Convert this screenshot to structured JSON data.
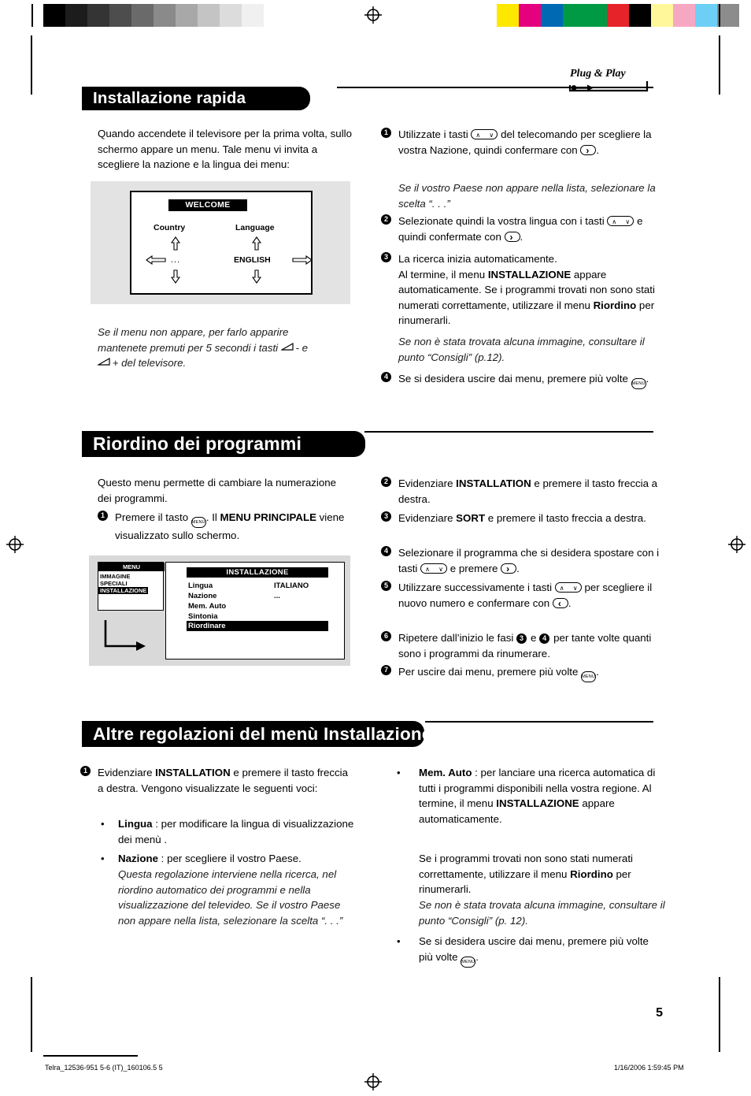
{
  "print_marks": {
    "gray_swatches": [
      "#000000",
      "#1a1a1a",
      "#333333",
      "#4d4d4d",
      "#666666",
      "#808080",
      "#999999",
      "#b3b3b3",
      "#cccccc",
      "#e6e6e6",
      "#ffffff"
    ],
    "color_swatches": [
      "#ffffff",
      "#ffee00",
      "#ec008c",
      "#0066b3",
      "#00a651",
      "#00a651",
      "#ed1c24",
      "#000000",
      "#fff799",
      "#f7a8c4",
      "#6dcff6",
      "#808080"
    ]
  },
  "brand": {
    "plug_and_play": "Plug & Play"
  },
  "sections": [
    {
      "id": "installazione-rapida",
      "title": "Installazione rapida",
      "intro": "Quando accendete il televisore per la prima volta, sullo schermo appare un menu. Tale menu vi invita a scegliere la nazione e la lingua dei menu:",
      "caption_italic": "Se il menu non appare, per farlo apparire mantenete premuti per 5 secondi i tasti      - e      + del televisore.",
      "screen": {
        "header": "WELCOME",
        "col1_label": "Country",
        "col2_label": "Language",
        "col1_value": "...",
        "col2_value": "ENGLISH"
      },
      "steps": [
        {
          "n": "1",
          "text_parts": [
            "Utilizzate i tasti ",
            " del telecomando per scegliere la vostra Nazione, quindi confermare con ",
            "."
          ],
          "note": "Se il vostro Paese non appare nella lista, selezionare la scelta “. . .”"
        },
        {
          "n": "2",
          "text_parts": [
            "Selezionate quindi la vostra lingua con i tasti ",
            " e quindi confermate con ",
            "."
          ]
        },
        {
          "n": "3",
          "line1": "La ricerca inizia automaticamente.",
          "line2_pre": "Al termine, il menu ",
          "line2_bold": "INSTALLAZIONE",
          "line2_post": " appare automaticamente. Se i programmi trovati non sono stati numerati correttamente, utilizzare il menu ",
          "line2_bold2": "Riordino",
          "line2_post2": " per rinumerarli.",
          "note": "Se non è stata trovata alcuna immagine, consultare il punto “Consigli” (p.12)."
        },
        {
          "n": "4",
          "text_parts": [
            "Se si desidera uscire dai menu, premere più volte ",
            "."
          ]
        }
      ]
    },
    {
      "id": "riordino-dei-programmi",
      "title": "Riordino dei programmi",
      "intro": "Questo menu permette di cambiare la numerazione dei programmi.",
      "left_step": {
        "n": "1",
        "pre": "Premere il tasto ",
        "mid": ". Il ",
        "bold": "MENU PRINCIPALE",
        "post": " viene visualizzato sullo schermo."
      },
      "screen": {
        "menu_title": "MENU",
        "menu_items": [
          "IMMAGINE",
          "SPECIALI",
          "INSTALLAZIONE"
        ],
        "menu_selected": "INSTALLAZIONE",
        "panel_title": "INSTALLAZIONE",
        "rows": [
          {
            "label": "Lingua",
            "value": "ITALIANO"
          },
          {
            "label": "Nazione",
            "value": "..."
          },
          {
            "label": "Mem. Auto",
            "value": ""
          },
          {
            "label": "Sintonia",
            "value": ""
          },
          {
            "label": "Riordinare",
            "value": ""
          }
        ],
        "panel_selected": "Riordinare"
      },
      "steps": [
        {
          "n": "2",
          "pre": "Evidenziare ",
          "bold": "INSTALLATION",
          "post": " e premere il tasto freccia a destra."
        },
        {
          "n": "3",
          "pre": "Evidenziare ",
          "bold": "SORT",
          "post": " e premere il tasto freccia a destra."
        },
        {
          "n": "4",
          "pre": "Selezionare il programma che si desidera spostare con i tasti ",
          "post": " e premere ",
          "post2": "."
        },
        {
          "n": "5",
          "pre": "Utilizzare successivamente i tasti ",
          "post": " per scegliere il nuovo numero e confermare con ",
          "post2": "."
        },
        {
          "n": "6",
          "pre": "Ripetere dall’inizio le fasi ",
          "mid": " e ",
          "post": " per tante volte quanti sono i programmi da rinumerare.",
          "ref1": "3",
          "ref2": "4"
        },
        {
          "n": "7",
          "pre": "Per uscire dai menu, premere più volte ",
          "post": "."
        }
      ]
    },
    {
      "id": "altre-regolazioni",
      "title": "Altre regolazioni del menù Installazione",
      "left": {
        "step": {
          "n": "1",
          "pre": "Evidenziare ",
          "bold": "INSTALLATION",
          "post": " e premere il tasto freccia a destra. Vengono visualizzate le seguenti voci:"
        },
        "bullets": [
          {
            "bold": "Lingua",
            "text": " : per modificare la lingua di visualizzazione dei menù ."
          },
          {
            "bold": "Nazione",
            "text": " : per scegliere il vostro Paese.",
            "note": "Questa regolazione interviene nella ricerca, nel riordino automatico dei programmi e nella visualizzazione del televideo. Se il vostro Paese non appare nella lista, selezionare la scelta “. . .”"
          }
        ]
      },
      "right": {
        "bullets": [
          {
            "bold": "Mem. Auto",
            "text": " : per lanciare una ricerca automatica di tutti i programmi disponibili nella vostra regione. Al termine, il menu ",
            "bold2": "INSTALLAZIONE",
            "text2": " appare automaticamente.",
            "text3": "Se i programmi trovati non sono stati numerati correttamente, utilizzare il menu ",
            "bold3": "Riordino",
            "text4": " per rinumerarli.",
            "note": "Se non è stata trovata alcuna immagine, consultare il punto “Consigli” (p. 12)."
          },
          {
            "text": "Se si desidera uscire dai menu, premere più volte ",
            "text2": "."
          }
        ]
      }
    }
  ],
  "page_number": "5",
  "footer": {
    "left": "Telra_12536-951 5-6 (IT)_160106.5     5",
    "right": "1/16/2006    1:59:45 PM"
  },
  "icons": {
    "menu_key": "MENU",
    "up_key": "∧",
    "down_key": "∨",
    "right_key": "›",
    "left_key": "‹",
    "volume": "volume-icon"
  }
}
